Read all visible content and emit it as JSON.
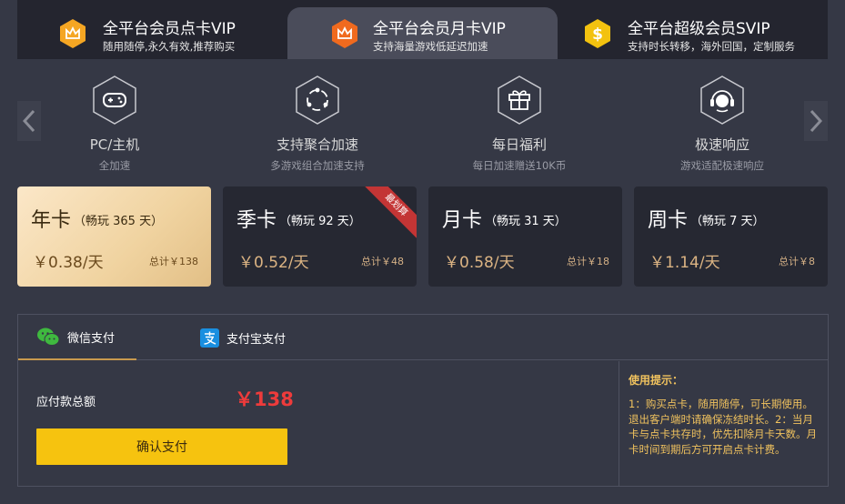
{
  "colors": {
    "background": "#353845",
    "gold": "#dcb483",
    "price_red": "#ee3b3b",
    "confirm_yellow": "#f6c30f",
    "tip_yellow": "#f0c25e"
  },
  "membership_tabs": [
    {
      "title": "全平台会员点卡VIP",
      "subtitle": "随用随停,永久有效,推荐购买",
      "icon": "crown-icon",
      "active": false
    },
    {
      "title": "全平台会员月卡VIP",
      "subtitle": "支持海量游戏低延迟加速",
      "icon": "crown-icon",
      "active": true
    },
    {
      "title": "全平台超级会员SVIP",
      "subtitle": "支持时长转移，海外回国，定制服务",
      "icon": "dollar-icon",
      "active": false
    }
  ],
  "features": [
    {
      "icon": "gamepad-icon",
      "title": "PC/主机",
      "subtitle": "全加速"
    },
    {
      "icon": "aggregate-icon",
      "title": "支持聚合加速",
      "subtitle": "多游戏组合加速支持"
    },
    {
      "icon": "gift-icon",
      "title": "每日福利",
      "subtitle": "每日加速赠送10K币"
    },
    {
      "icon": "headset-icon",
      "title": "极速响应",
      "subtitle": "游戏适配极速响应"
    }
  ],
  "plans": [
    {
      "name": "年卡",
      "duration": "（畅玩 365 天）",
      "price": "￥0.38/天",
      "total": "总计￥138",
      "active": true
    },
    {
      "name": "季卡",
      "duration": "（畅玩 92 天）",
      "price": "￥0.52/天",
      "total": "总计￥48",
      "ribbon": "最划算"
    },
    {
      "name": "月卡",
      "duration": "（畅玩 31 天）",
      "price": "￥0.58/天",
      "total": "总计￥18"
    },
    {
      "name": "周卡",
      "duration": "（畅玩 7 天）",
      "price": "￥1.14/天",
      "total": "总计￥8"
    }
  ],
  "payment": {
    "methods": [
      {
        "label": "微信支付",
        "icon": "wechat-icon",
        "active": true
      },
      {
        "label": "支付宝支付",
        "icon": "alipay-icon",
        "active": false
      }
    ],
    "amount_label": "应付款总额",
    "amount": "￥138",
    "confirm_label": "确认支付",
    "tips_title": "使用提示：",
    "tips_text": "1：购买点卡，随用随停，可长期使用。退出客户端时请确保冻结时长。2：当月卡与点卡共存时，优先扣除月卡天数。月卡时间到期后方可开启点卡计费。"
  }
}
